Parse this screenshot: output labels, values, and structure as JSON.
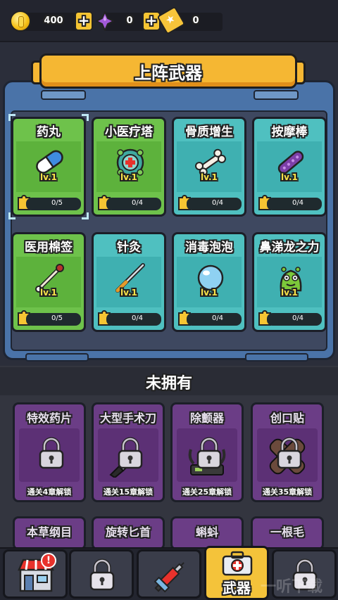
{
  "currencies": {
    "coins": "400",
    "gems": "0",
    "tickets": "0"
  },
  "equipped": {
    "title": "上阵武器",
    "cards": [
      {
        "name": "药丸",
        "level": "lv.1",
        "count": "0/5",
        "style": "green",
        "icon": "pill-icon"
      },
      {
        "name": "小医疗塔",
        "level": "lv.1",
        "count": "0/4",
        "style": "green",
        "icon": "medical-tower-icon"
      },
      {
        "name": "骨质增生",
        "level": "lv.1",
        "count": "0/4",
        "style": "teal",
        "icon": "bone-icon"
      },
      {
        "name": "按摩棒",
        "level": "lv.1",
        "count": "0/4",
        "style": "teal",
        "icon": "massage-stick-icon"
      },
      {
        "name": "医用棉签",
        "level": "lv.1",
        "count": "0/5",
        "style": "green",
        "icon": "cotton-swab-icon"
      },
      {
        "name": "针灸",
        "level": "lv.1",
        "count": "0/4",
        "style": "teal",
        "icon": "acupuncture-needle-icon"
      },
      {
        "name": "消毒泡泡",
        "level": "lv.1",
        "count": "0/4",
        "style": "teal",
        "icon": "bubble-icon"
      },
      {
        "name": "鼻涕龙之力",
        "level": "lv.1",
        "count": "0/4",
        "style": "teal",
        "icon": "snot-dragon-icon"
      }
    ]
  },
  "not_owned": {
    "title": "未拥有",
    "cards": [
      {
        "name": "特效药片",
        "unlock": "通关4章解锁",
        "icon": "lock-icon"
      },
      {
        "name": "大型手术刀",
        "unlock": "通关15章解锁",
        "icon": "scalpel-lock-icon"
      },
      {
        "name": "除颤器",
        "unlock": "通关25章解锁",
        "icon": "defibrillator-lock-icon"
      },
      {
        "name": "创口贴",
        "unlock": "通关35章解锁",
        "icon": "bandage-lock-icon"
      },
      {
        "name": "本草纲目",
        "unlock": "",
        "icon": "lock-icon"
      },
      {
        "name": "旋转匕首",
        "unlock": "",
        "icon": "lock-icon"
      },
      {
        "name": "蝌蚪",
        "unlock": "",
        "icon": "lock-icon"
      },
      {
        "name": "一根毛",
        "unlock": "",
        "icon": "lock-icon"
      }
    ]
  },
  "bottom_nav": {
    "items": [
      {
        "icon": "shop-icon",
        "badge": "!"
      },
      {
        "icon": "locked-icon"
      },
      {
        "icon": "syringe-icon"
      },
      {
        "icon": "weapons-case-icon",
        "label": "武器",
        "active": true
      },
      {
        "icon": "locked-icon"
      }
    ]
  },
  "watermark": "一听下载",
  "colors": {
    "accent": "#f4c33a",
    "green_card": "#6ec24b",
    "teal_card": "#4fc0c0",
    "locked_card": "#6b3d86",
    "level_text": "#f9e24a"
  }
}
